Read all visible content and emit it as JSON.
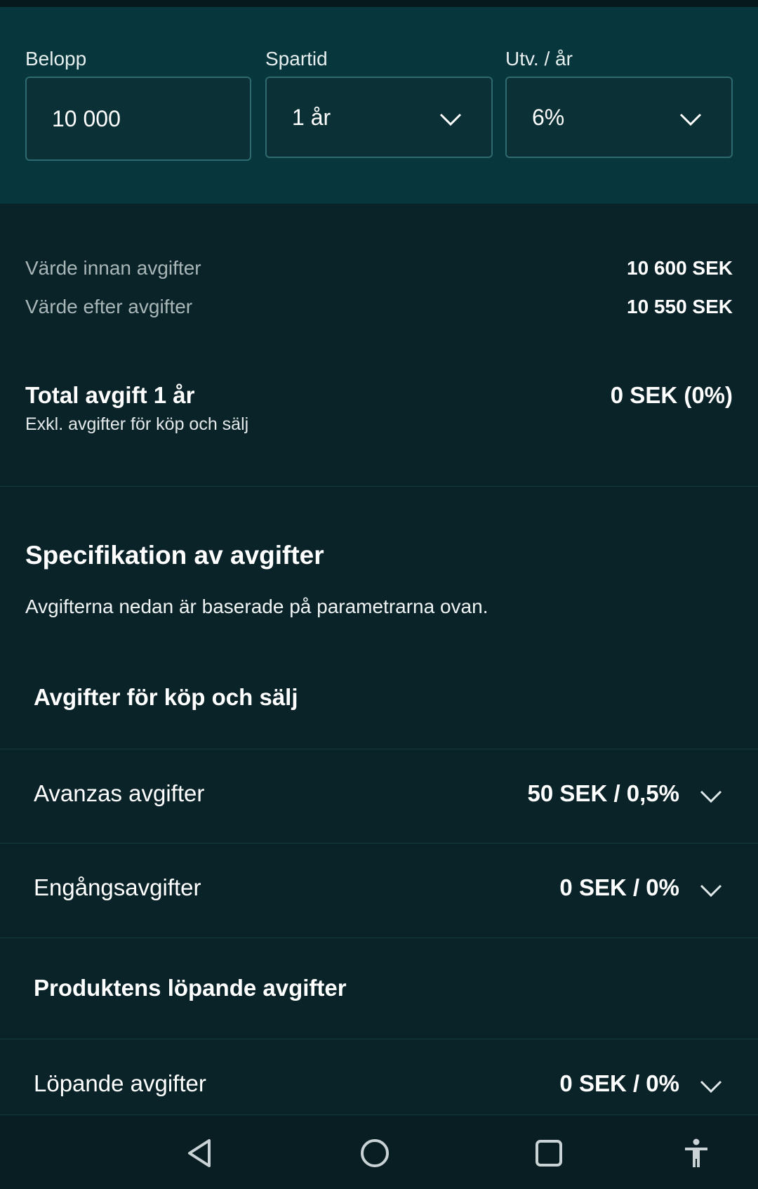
{
  "params": {
    "belopp": {
      "label": "Belopp",
      "value": "10 000"
    },
    "spartid": {
      "label": "Spartid",
      "value": "1 år"
    },
    "utveckling": {
      "label": "Utv. / år",
      "value": "6%"
    }
  },
  "summary": {
    "before_label": "Värde innan avgifter",
    "before_value": "10 600 SEK",
    "after_label": "Värde efter avgifter",
    "after_value": "10 550 SEK"
  },
  "total": {
    "title": "Total avgift 1 år",
    "subtitle": "Exkl. avgifter för köp och sälj",
    "value": "0 SEK (0%)"
  },
  "spec": {
    "title": "Specifikation av avgifter",
    "description": "Avgifterna nedan är baserade på parametrarna ovan."
  },
  "groups": {
    "buy_sell": {
      "title": "Avgifter för köp och sälj",
      "rows": [
        {
          "label": "Avanzas avgifter",
          "value": "50 SEK / 0,5%"
        },
        {
          "label": "Engångsavgifter",
          "value": "0 SEK / 0%"
        }
      ]
    },
    "running": {
      "title": "Produktens löpande avgifter",
      "rows": [
        {
          "label": "Löpande avgifter",
          "value": "0 SEK / 0%"
        }
      ]
    }
  },
  "navbar": {
    "icons": [
      "back-icon",
      "home-icon",
      "recents-icon",
      "accessibility-icon"
    ]
  }
}
